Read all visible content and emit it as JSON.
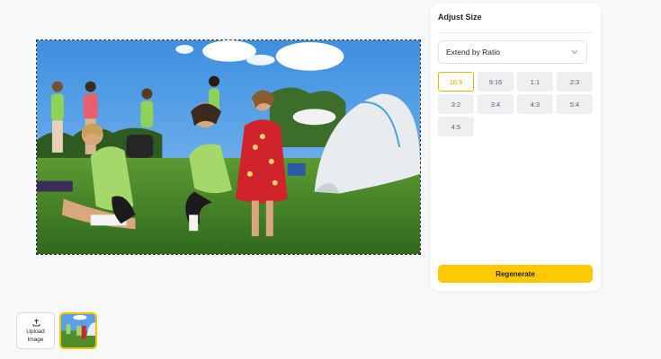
{
  "panel": {
    "title": "Adjust Size",
    "select_value": "Extend by Ratio",
    "ratios": [
      "16:9",
      "9:16",
      "1:1",
      "2:3",
      "3:2",
      "3:4",
      "4:3",
      "5:4",
      "4:5"
    ],
    "selected_ratio": "16:9",
    "regenerate_label": "Regenerate"
  },
  "bottom": {
    "upload_label": "Upload\nImage"
  },
  "colors": {
    "accent": "#ffc800",
    "selected_border": "#f0b400"
  },
  "icons": {
    "select": "chevron-down-icon",
    "upload": "upload-icon"
  }
}
